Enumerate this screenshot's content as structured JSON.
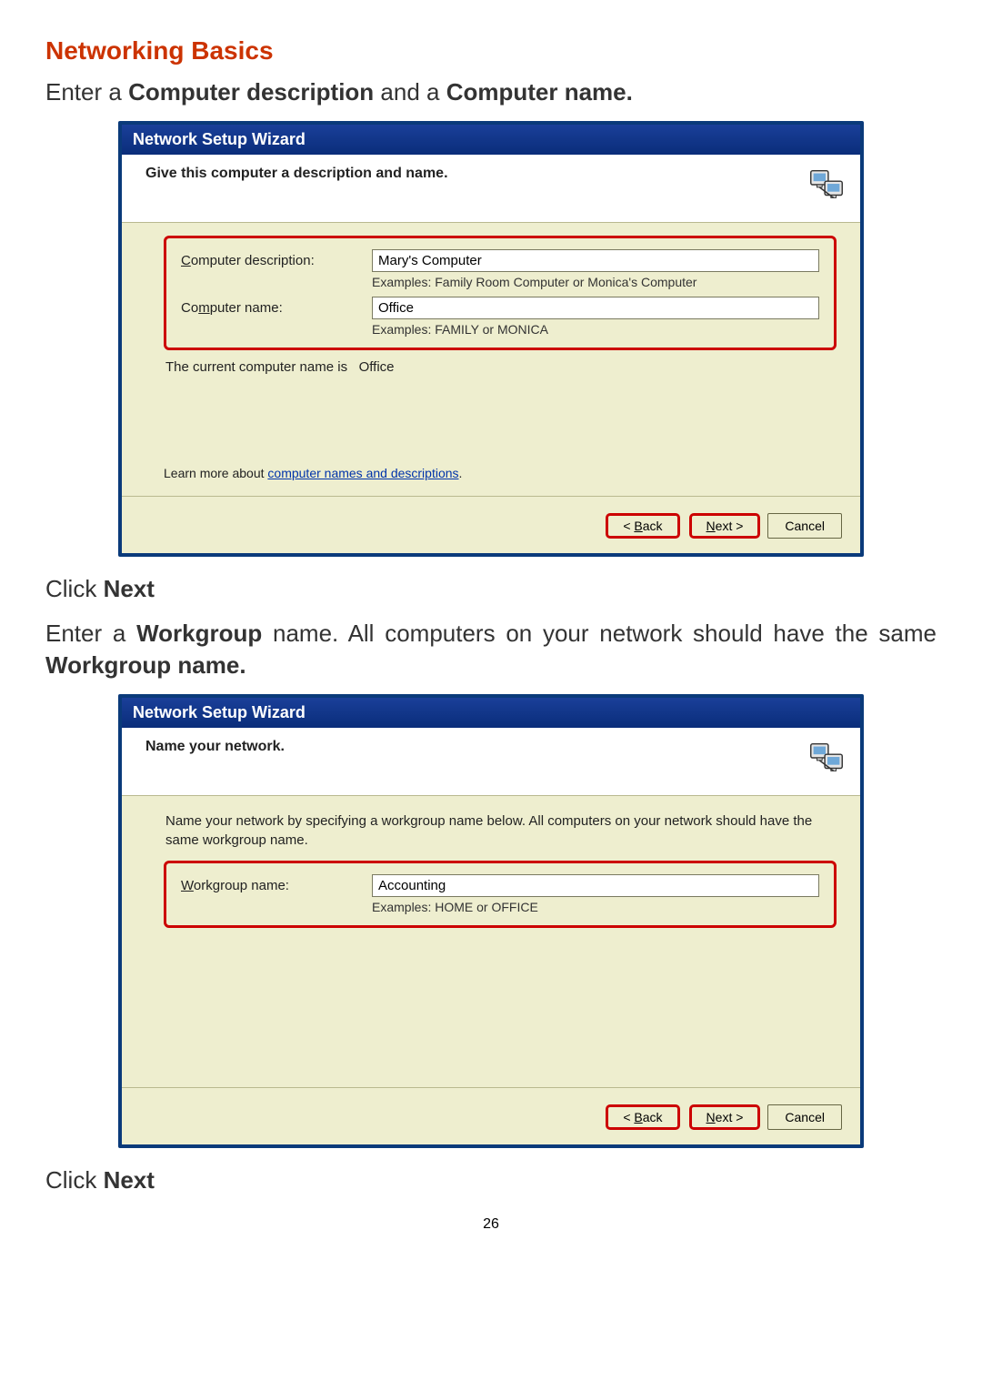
{
  "heading": "Networking Basics",
  "intro1_pre": "Enter a ",
  "intro1_b1": "Computer description",
  "intro1_mid": " and a ",
  "intro1_b2": "Computer name.",
  "wizard1": {
    "title": "Network Setup Wizard",
    "subtitle": "Give this computer a description and name.",
    "desc_label_pre": "C",
    "desc_label_rest": "omputer description:",
    "desc_value": "Mary's Computer",
    "desc_hint": "Examples: Family Room Computer or Monica's Computer",
    "name_label_pre": "Co",
    "name_label_mid": "m",
    "name_label_rest": "puter name:",
    "name_value": "Office",
    "name_hint": "Examples: FAMILY or MONICA",
    "current_name_pre": "The current computer name is ",
    "current_name_val": "Office",
    "learn_pre": "Learn more about ",
    "learn_link": "computer names and descriptions",
    "learn_post": ".",
    "back_pre": "< ",
    "back_ul": "B",
    "back_rest": "ack",
    "next_ul": "N",
    "next_rest": "ext >",
    "cancel": "Cancel"
  },
  "click_next": "Click ",
  "click_next_b": "Next",
  "intro2_pre": "Enter a ",
  "intro2_b1": "Workgroup",
  "intro2_mid": " name.  All computers on your network should have the same ",
  "intro2_b2": "Workgroup name.",
  "wizard2": {
    "title": "Network Setup Wizard",
    "subtitle": "Name your network.",
    "instruction": "Name your network by specifying a workgroup name below. All computers on your network should have the same workgroup name.",
    "wg_label_ul": "W",
    "wg_label_rest": "orkgroup name:",
    "wg_value": "Accounting",
    "wg_hint": "Examples: HOME or OFFICE",
    "back_pre": "< ",
    "back_ul": "B",
    "back_rest": "ack",
    "next_ul": "N",
    "next_rest": "ext >",
    "cancel": "Cancel"
  },
  "page_number": "26"
}
